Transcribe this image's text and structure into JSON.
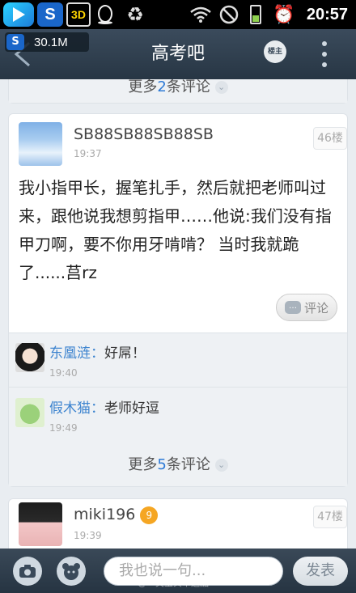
{
  "status_bar": {
    "time": "20:57",
    "app_badge_3": "3D",
    "s_badge": "S"
  },
  "title_bar": {
    "title": "高考吧",
    "data_speed": "30.1M",
    "owner_badge": "楼主"
  },
  "top_card": {
    "more_prefix": "更多",
    "more_count": "2",
    "more_suffix": "条评论"
  },
  "post": {
    "author": "SB88SB88SB88SB",
    "time": "19:37",
    "floor": "46楼",
    "text": "我小指甲长，握笔扎手，然后就把老师叫过来，跟他说我想剪指甲……他说:我们没有指甲刀啊，要不你用牙啃啃？ 当时我就跪了......莒rz",
    "comment_button": "评论",
    "comments": [
      {
        "name": "东凰涟",
        "sep": "：",
        "text": "好屌！",
        "time": "19:40"
      },
      {
        "name": "假木猫",
        "sep": "：",
        "text": "老师好逗",
        "time": "19:49"
      }
    ],
    "more_prefix": "更多",
    "more_count": "5",
    "more_suffix": "条评论"
  },
  "next_post": {
    "author": "miki196",
    "level": "9",
    "time": "19:39",
    "floor": "47楼"
  },
  "bottom_bar": {
    "input_placeholder": "我也说一句...",
    "send_label": "发表",
    "watermark": "@一笑宝贝幸运酷"
  }
}
